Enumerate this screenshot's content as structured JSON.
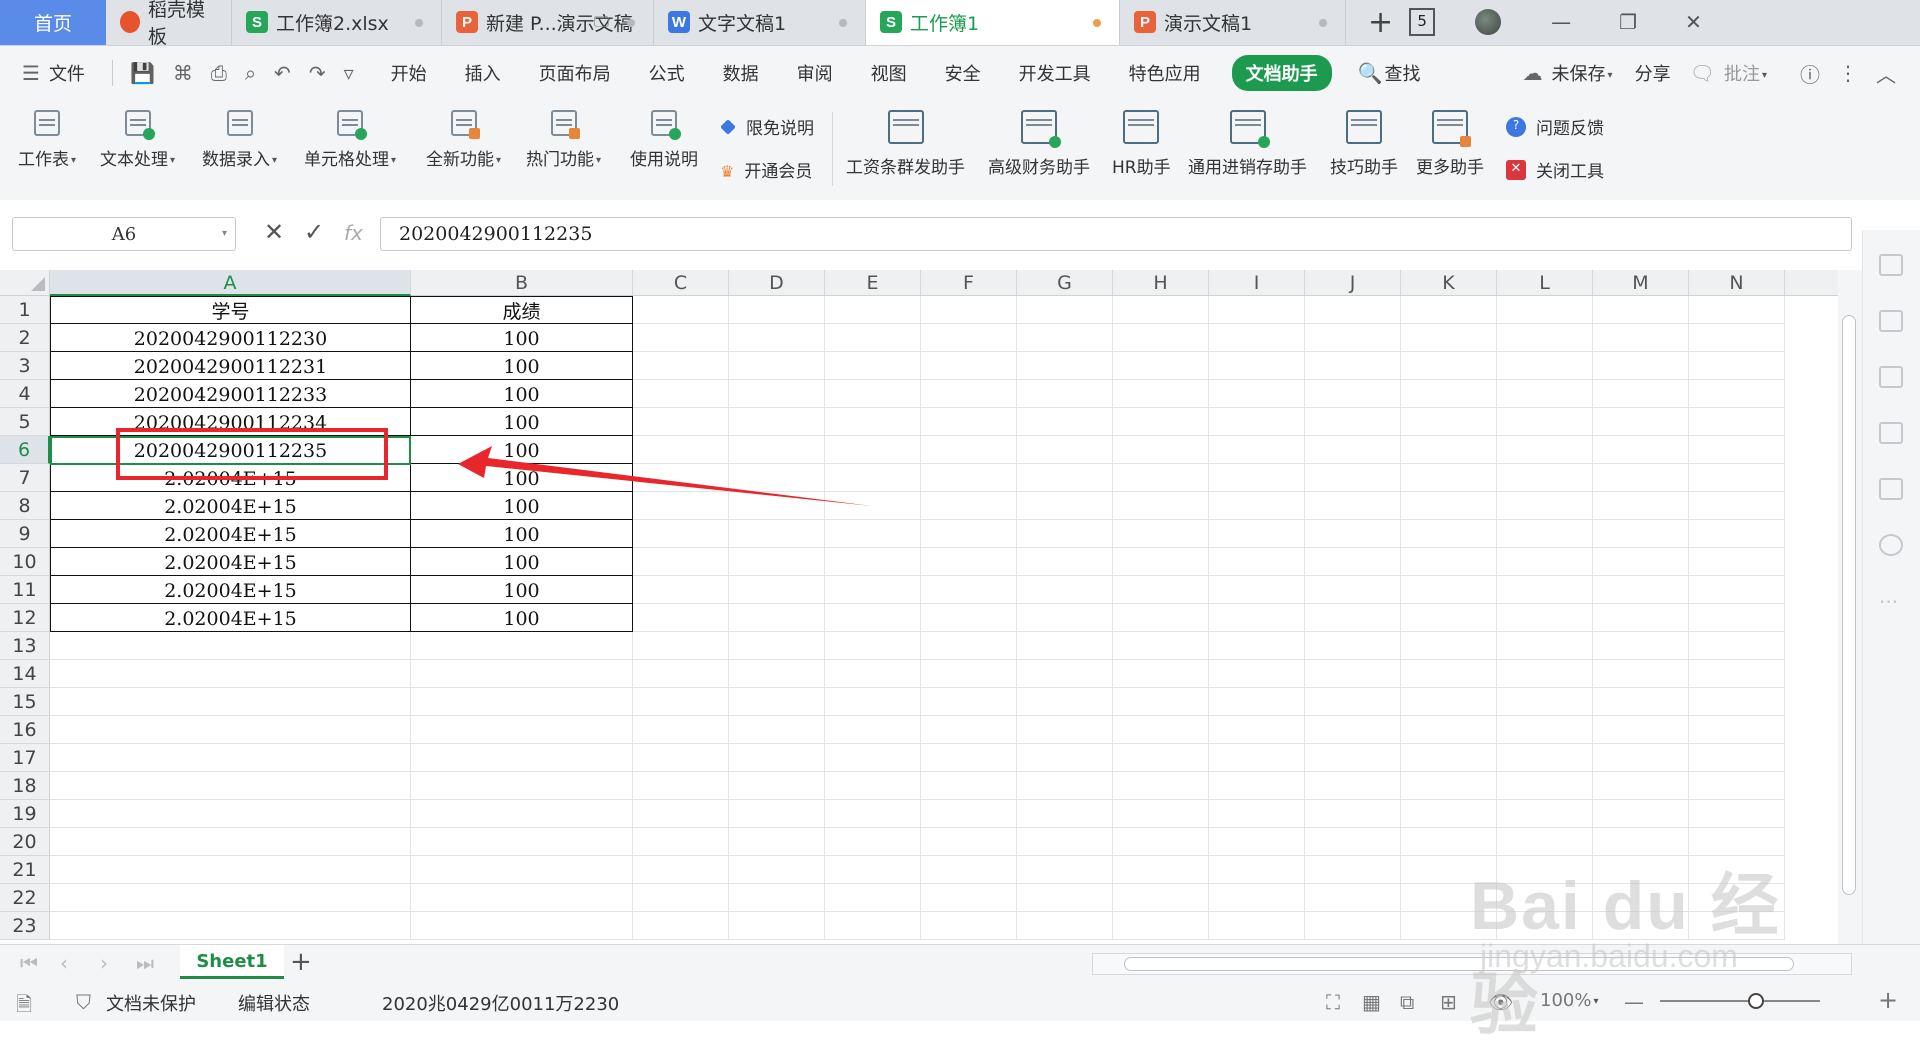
{
  "tabs": [
    {
      "label": "首页",
      "type": "home"
    },
    {
      "label": "稻壳模板",
      "icon": "docer-icon"
    },
    {
      "label": "工作簿2.xlsx",
      "icon": "spreadsheet-file-icon"
    },
    {
      "label": "新建 P...演示文稿",
      "icon": "presentation-file-icon"
    },
    {
      "label": "文字文稿1",
      "icon": "writer-file-icon"
    },
    {
      "label": "工作簿1",
      "icon": "spreadsheet-file-icon",
      "active": true
    },
    {
      "label": "演示文稿1",
      "icon": "presentation-file-icon"
    }
  ],
  "tab_icon_letters": {
    "s": "S",
    "p": "P",
    "w": "W"
  },
  "tab_count": "5",
  "menu": {
    "file": "文件",
    "items": [
      "开始",
      "插入",
      "页面布局",
      "公式",
      "数据",
      "审阅",
      "视图",
      "安全",
      "开发工具",
      "特色应用"
    ],
    "active": "文档助手",
    "search": "查找",
    "unsaved": "未保存",
    "share": "分享",
    "comment": "批注"
  },
  "ribbon": {
    "buttons": [
      "工作表",
      "文本处理",
      "数据录入",
      "单元格处理",
      "全新功能",
      "热门功能",
      "使用说明"
    ],
    "free_desc": "限免说明",
    "vip": "开通会员",
    "helpers": [
      "工资条群发助手",
      "高级财务助手",
      "HR助手",
      "通用进销存助手",
      "技巧助手",
      "更多助手"
    ],
    "feedback": "问题反馈",
    "close_tool": "关闭工具"
  },
  "formula_bar": {
    "cell_ref": "A6",
    "fx": "fx",
    "value": "2020042900112235"
  },
  "columns": [
    "A",
    "B",
    "C",
    "D",
    "E",
    "F",
    "G",
    "H",
    "I",
    "J",
    "K",
    "L",
    "M",
    "N"
  ],
  "selected_column": "A",
  "rows": [
    "1",
    "2",
    "3",
    "4",
    "5",
    "6",
    "7",
    "8",
    "9",
    "10",
    "11",
    "12",
    "13",
    "14",
    "15",
    "16",
    "17",
    "18",
    "19",
    "20",
    "21",
    "22",
    "23"
  ],
  "selected_row": "6",
  "table": {
    "headers": [
      "学号",
      "成绩"
    ],
    "rows": [
      [
        "2020042900112230",
        "100"
      ],
      [
        "2020042900112231",
        "100"
      ],
      [
        "2020042900112233",
        "100"
      ],
      [
        "2020042900112234",
        "100"
      ],
      [
        "2020042900112235",
        "100"
      ],
      [
        "2.02004E+15",
        "100"
      ],
      [
        "2.02004E+15",
        "100"
      ],
      [
        "2.02004E+15",
        "100"
      ],
      [
        "2.02004E+15",
        "100"
      ],
      [
        "2.02004E+15",
        "100"
      ],
      [
        "2.02004E+15",
        "100"
      ]
    ]
  },
  "sheet": {
    "name": "Sheet1"
  },
  "status": {
    "protect": "文档未保护",
    "mode": "编辑状态",
    "readout": "2020兆0429亿0011万2230",
    "zoom": "100%"
  },
  "watermark": {
    "logo": "Bai du 经验",
    "url": "jingyan.baidu.com"
  },
  "colors": {
    "accent": "#1e8e47",
    "annotation": "#e8262c",
    "home_tab": "#5b8be8"
  }
}
